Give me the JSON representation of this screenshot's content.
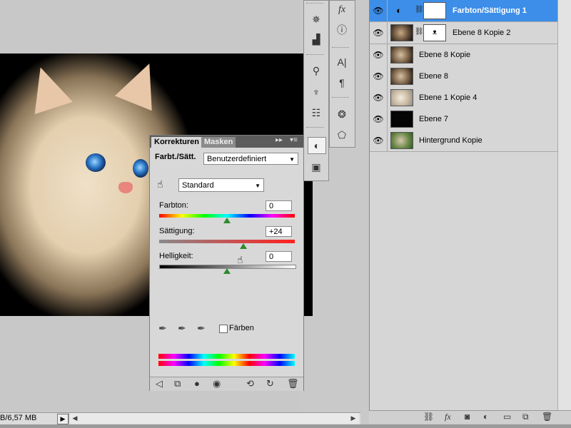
{
  "status": {
    "doc_size": "B/6,57 MB"
  },
  "tools_col1": {
    "icons": [
      "navigator-icon",
      "histogram-icon",
      "brushes-icon",
      "clone-source-icon",
      "tool-presets-icon",
      "adjustments-icon",
      "masks-icon"
    ]
  },
  "tools_col2": {
    "icons": [
      "styles-icon",
      "info-icon",
      "character-icon",
      "paragraph-icon",
      "channels-icon",
      "paths-icon"
    ]
  },
  "adjustments": {
    "tab_active": "Korrekturen",
    "tab_inactive": "Masken",
    "title": "Farbt./Sätt.",
    "preset": "Benutzerdefiniert",
    "channel": "Standard",
    "hue_label": "Farbton:",
    "hue_value": "0",
    "saturation_label": "Sättigung:",
    "saturation_value": "+24",
    "lightness_label": "Helligkeit:",
    "lightness_value": "0",
    "colorize_label": "Färben",
    "hue_slider": 0.5,
    "saturation_slider": 0.62,
    "lightness_slider": 0.5
  },
  "layers": [
    {
      "name": "Farbton/Sättigung 1",
      "selected": true,
      "thumb": "adjustment"
    },
    {
      "name": "Ebene 8 Kopie 2",
      "selected": false,
      "thumb": "masked"
    },
    {
      "name": "Ebene 8 Kopie",
      "selected": false,
      "thumb": "kitten"
    },
    {
      "name": "Ebene 8",
      "selected": false,
      "thumb": "kitten"
    },
    {
      "name": "Ebene 1 Kopie 4",
      "selected": false,
      "thumb": "kitten-light"
    },
    {
      "name": "Ebene 7",
      "selected": false,
      "thumb": "black"
    },
    {
      "name": "Hintergrund Kopie",
      "selected": false,
      "thumb": "kitten-green"
    }
  ]
}
